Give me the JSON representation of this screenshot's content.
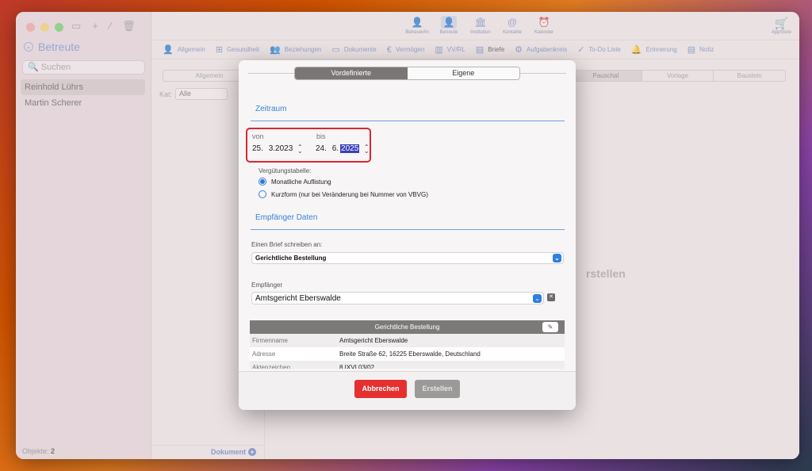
{
  "sidebar": {
    "title": "Betreute",
    "search_placeholder": "Suchen",
    "items": [
      "Reinhold Lührs",
      "Martin Scherer"
    ],
    "footer_label": "Objekte:",
    "footer_count": "2"
  },
  "toolbar": {
    "buttons": [
      "Betreuer/in",
      "Betreute",
      "Institution",
      "Kontakte",
      "Kalender"
    ],
    "appstore": "AppStore"
  },
  "tabs": [
    "Allgemein",
    "Gesundheit",
    "Beziehungen",
    "Dokumente",
    "Vermögen",
    "VV/RL",
    "Briefe",
    "Aufgabenkreis",
    "To-Do Liste",
    "Erinnerung",
    "Notiz"
  ],
  "main": {
    "left_tab": "Allgemein",
    "kat_label": "Kat:",
    "kat_value": "Alle",
    "right_tabs": [
      "Pauschal",
      "Vorlage",
      "Baustein"
    ],
    "background_text": "rstellen",
    "footer_button": "Dokument"
  },
  "dialog": {
    "segments": [
      "Vordefinierte",
      "Eigene"
    ],
    "zeitraum_title": "Zeitraum",
    "von_label": "von",
    "von_day": "25.",
    "von_rest": "3.2023",
    "bis_label": "bis",
    "bis_day": "24.",
    "bis_month": "6.",
    "bis_year": "2025",
    "verguetung_label": "Vergütungstabelle:",
    "radio1": "Monatliche Auflistung",
    "radio2": "Kurzform (nur bei Veränderung bei Nummer von VBVG)",
    "empfaenger_title": "Empfänger Daten",
    "brief_label": "Einen Brief schreiben an:",
    "brief_value": "Gerichtliche Bestellung",
    "empfaenger_label": "Empfänger",
    "empfaenger_value": "Amtsgericht Eberswalde",
    "table_title": "Gerichtliche Bestellung",
    "table_rows": [
      [
        "Firmenname",
        "Amtsgericht Eberswalde"
      ],
      [
        "Adresse",
        "Breite Straße 62, 16225 Eberswalde, Deutschland"
      ],
      [
        "Aktenzeichen",
        "8 IXVI 03/02"
      ]
    ],
    "cancel": "Abbrechen",
    "create": "Erstellen"
  },
  "colors": {
    "accent": "#3a83d9",
    "cancel": "#e53030",
    "highlight": "#d9272e"
  }
}
